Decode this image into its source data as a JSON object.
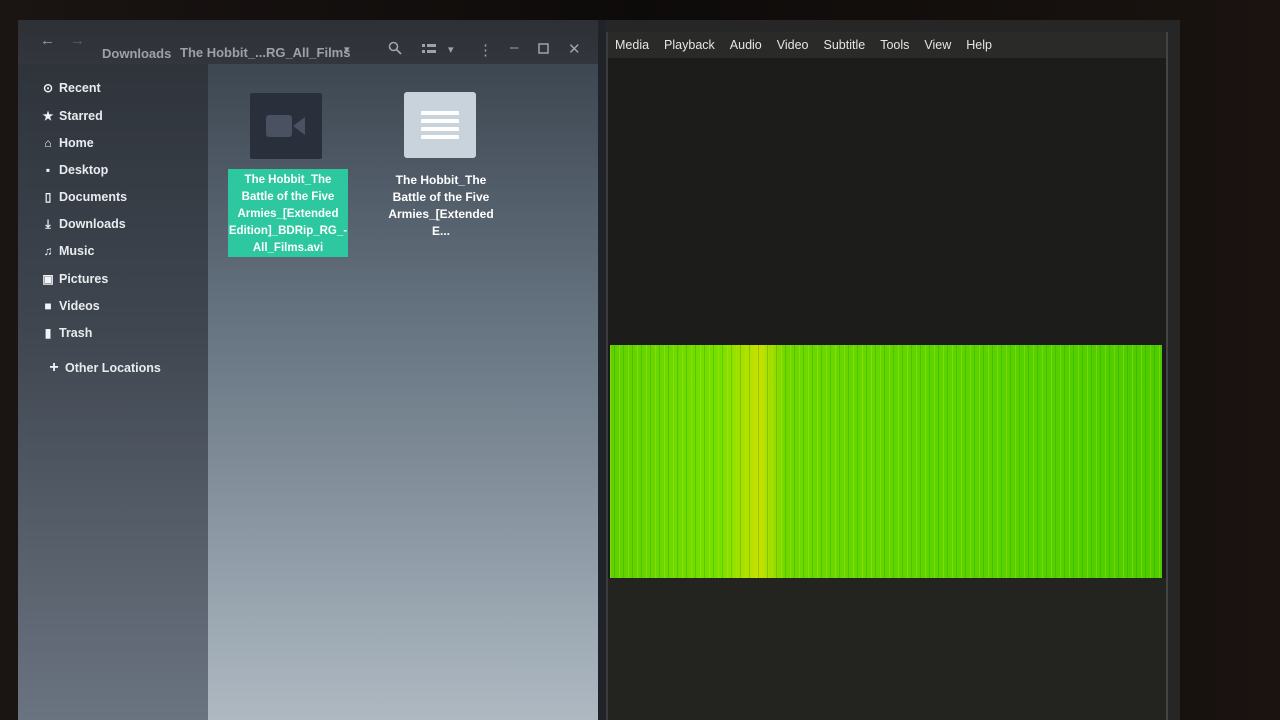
{
  "file_manager": {
    "header": {
      "path_buttons": [
        "Downloads",
        "The Hobbit_...RG_All_Films"
      ],
      "icons": [
        "back-arrow-icon",
        "forward-arrow-icon",
        "search-icon",
        "view-toggle-icon",
        "chevron-down-icon",
        "kebab-menu-icon",
        "minimize-icon",
        "maximize-icon",
        "close-icon"
      ]
    },
    "sidebar": {
      "items": [
        {
          "label": "Recent",
          "icon": "clock-icon"
        },
        {
          "label": "Starred",
          "icon": "star-icon"
        },
        {
          "label": "Home",
          "icon": "home-icon"
        },
        {
          "label": "Desktop",
          "icon": "desktop-icon"
        },
        {
          "label": "Documents",
          "icon": "document-icon"
        },
        {
          "label": "Downloads",
          "icon": "download-icon"
        },
        {
          "label": "Music",
          "icon": "music-icon"
        },
        {
          "label": "Pictures",
          "icon": "picture-icon"
        },
        {
          "label": "Videos",
          "icon": "video-icon"
        },
        {
          "label": "Trash",
          "icon": "trash-icon"
        }
      ],
      "other_locations": "Other Locations"
    },
    "files": [
      {
        "name": "The Hobbit_The Battle of the Five Armies_[Extended Edition]_BDRip_RG_-All_Films.avi",
        "type": "video",
        "selected": true
      },
      {
        "name": "The Hobbit_The Battle of the Five Armies_[Extended E...",
        "type": "text",
        "selected": false
      }
    ]
  },
  "media_player": {
    "menu": [
      "Media",
      "Playback",
      "Audio",
      "Video",
      "Subtitle",
      "Tools",
      "View",
      "Help"
    ]
  },
  "colors": {
    "selection": "#2dc8a0",
    "video_green": "#5fd000"
  }
}
